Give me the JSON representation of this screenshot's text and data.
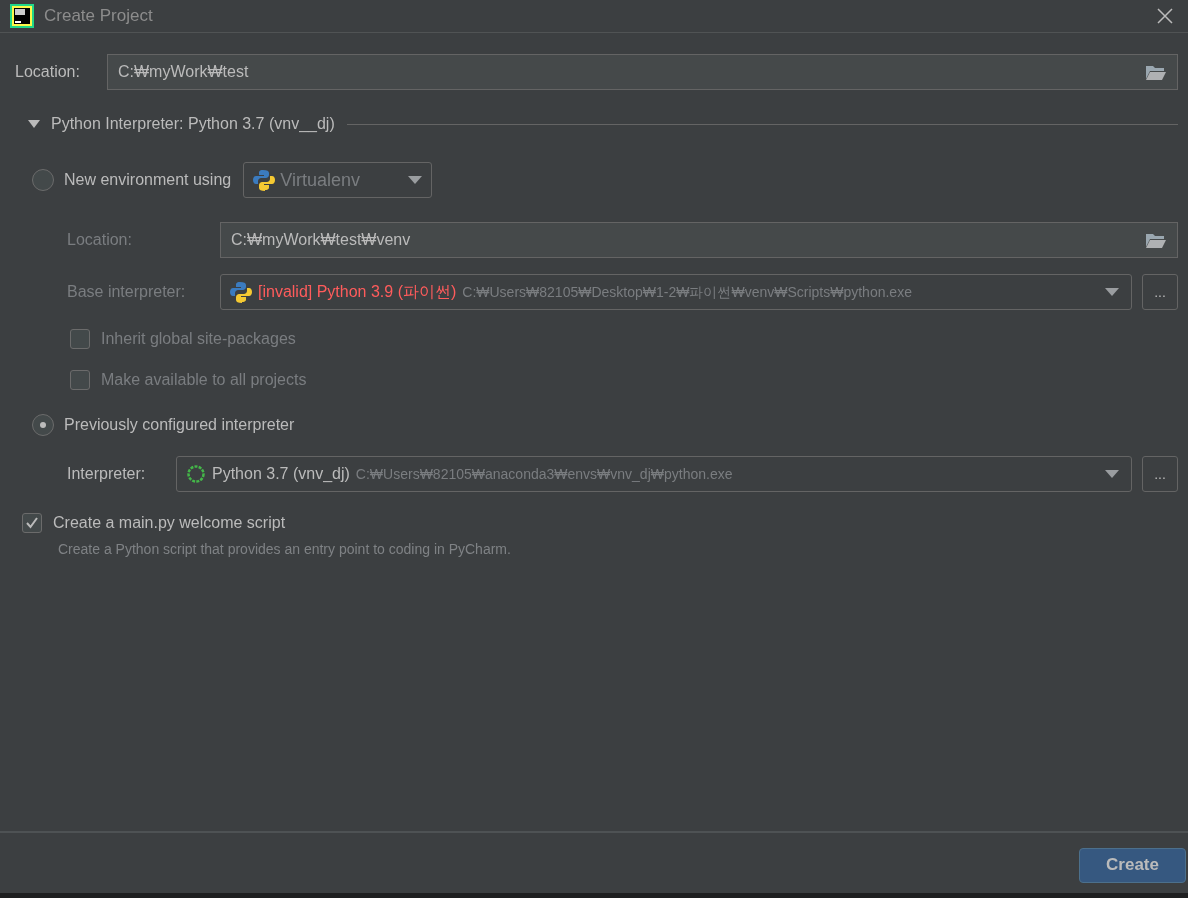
{
  "window": {
    "title": "Create Project"
  },
  "location": {
    "label": "Location:",
    "value": "C:₩myWork₩test"
  },
  "interpreter_section": {
    "title": "Python Interpreter: Python 3.7 (vnv__dj)",
    "expanded": true
  },
  "new_environment": {
    "label": "New environment using",
    "selected": false,
    "tool": "Virtualenv",
    "location": {
      "label": "Location:",
      "value": "C:₩myWork₩test₩venv"
    },
    "base_interpreter": {
      "label": "Base interpreter:",
      "name": "[invalid] Python 3.9 (파이썬)",
      "path": "C:₩Users₩82105₩Desktop₩1-2₩파이썬₩venv₩Scripts₩python.exe",
      "invalid": true,
      "browse": "..."
    },
    "checkboxes": [
      {
        "label": "Inherit global site-packages",
        "checked": false
      },
      {
        "label": "Make available to all projects",
        "checked": false
      }
    ]
  },
  "previous_interpreter": {
    "label": "Previously configured interpreter",
    "selected": true,
    "interpreter": {
      "label": "Interpreter:",
      "name": "Python 3.7 (vnv_dj)",
      "path": "C:₩Users₩82105₩anaconda3₩envs₩vnv_dj₩python.exe",
      "browse": "..."
    }
  },
  "welcome_script": {
    "label": "Create a main.py welcome script",
    "checked": true,
    "description": "Create a Python script that provides an entry point to coding in PyCharm."
  },
  "buttons": [
    {
      "label": "Create",
      "kind": "primary"
    }
  ]
}
